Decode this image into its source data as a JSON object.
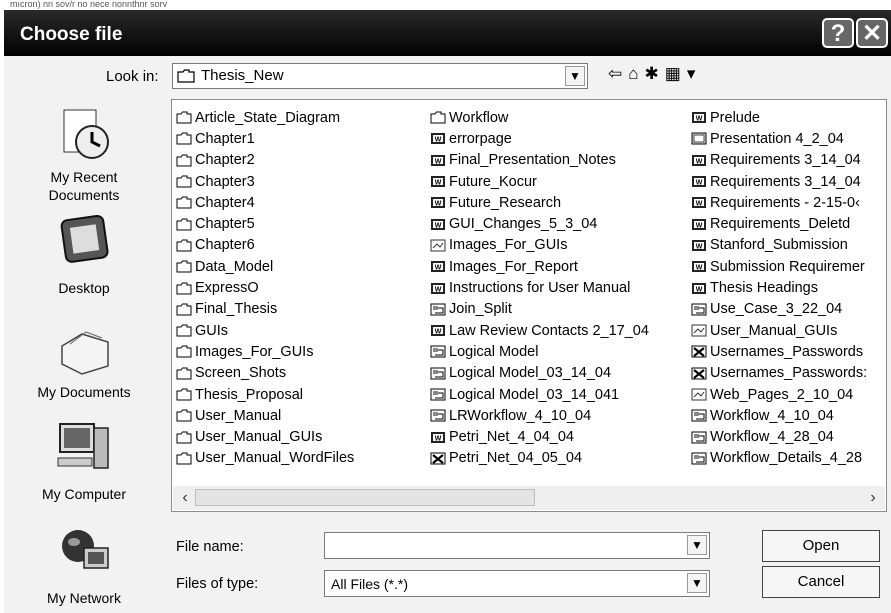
{
  "dialog": {
    "title": "Choose file",
    "help_glyph": "?",
    "close_glyph": "✕"
  },
  "scan_margin_text": "mıcron) nn sov/r no nece nonnthnr sorv",
  "look_in": {
    "label": "Look in:",
    "value": "Thesis_New",
    "dropdown_glyph": "▼"
  },
  "toolbar": {
    "icons": [
      "back-icon",
      "up-folder-icon",
      "new-folder-icon",
      "view-menu-icon"
    ],
    "glyphs": "⇦ ⌂ ✱ ▦▾"
  },
  "places": [
    {
      "label": "My Recent Documents",
      "icon": "recent-documents-icon"
    },
    {
      "label": "Desktop",
      "icon": "desktop-icon"
    },
    {
      "label": "My Documents",
      "icon": "my-documents-icon"
    },
    {
      "label": "My Computer",
      "icon": "my-computer-icon"
    },
    {
      "label": "My Network",
      "icon": "my-network-icon"
    }
  ],
  "files": {
    "columns": [
      [
        {
          "name": "Article_State_Diagram",
          "kind": "folder"
        },
        {
          "name": "Chapter1",
          "kind": "folder"
        },
        {
          "name": "Chapter2",
          "kind": "folder"
        },
        {
          "name": "Chapter3",
          "kind": "folder"
        },
        {
          "name": "Chapter4",
          "kind": "folder"
        },
        {
          "name": "Chapter5",
          "kind": "folder"
        },
        {
          "name": "Chapter6",
          "kind": "folder"
        },
        {
          "name": "Data_Model",
          "kind": "folder"
        },
        {
          "name": "ExpressO",
          "kind": "folder"
        },
        {
          "name": "Final_Thesis",
          "kind": "folder"
        },
        {
          "name": "GUIs",
          "kind": "folder"
        },
        {
          "name": "Images_For_GUIs",
          "kind": "folder"
        },
        {
          "name": "Screen_Shots",
          "kind": "folder"
        },
        {
          "name": "Thesis_Proposal",
          "kind": "folder"
        },
        {
          "name": "User_Manual",
          "kind": "folder"
        },
        {
          "name": "User_Manual_GUIs",
          "kind": "folder"
        },
        {
          "name": "User_Manual_WordFiles",
          "kind": "folder"
        }
      ],
      [
        {
          "name": "Workflow",
          "kind": "folder"
        },
        {
          "name": "errorpage",
          "kind": "word"
        },
        {
          "name": "Final_Presentation_Notes",
          "kind": "word"
        },
        {
          "name": "Future_Kocur",
          "kind": "word"
        },
        {
          "name": "Future_Research",
          "kind": "word"
        },
        {
          "name": "GUI_Changes_5_3_04",
          "kind": "word"
        },
        {
          "name": "Images_For_GUIs",
          "kind": "image"
        },
        {
          "name": "Images_For_Report",
          "kind": "word"
        },
        {
          "name": "Instructions for User Manual",
          "kind": "word"
        },
        {
          "name": "Join_Split",
          "kind": "visio"
        },
        {
          "name": "Law Review Contacts 2_17_04",
          "kind": "word"
        },
        {
          "name": "Logical Model",
          "kind": "visio"
        },
        {
          "name": "Logical Model_03_14_04",
          "kind": "visio"
        },
        {
          "name": "Logical Model_03_14_041",
          "kind": "visio"
        },
        {
          "name": "LRWorkflow_4_10_04",
          "kind": "visio"
        },
        {
          "name": "Petri_Net_4_04_04",
          "kind": "word"
        },
        {
          "name": "Petri_Net_04_05_04",
          "kind": "excel"
        }
      ],
      [
        {
          "name": "Prelude",
          "kind": "word"
        },
        {
          "name": "Presentation 4_2_04",
          "kind": "ppt"
        },
        {
          "name": "Requirements 3_14_04",
          "kind": "word"
        },
        {
          "name": "Requirements 3_14_04",
          "kind": "word"
        },
        {
          "name": "Requirements - 2-15-0‹",
          "kind": "word"
        },
        {
          "name": "Requirements_Deletd",
          "kind": "word"
        },
        {
          "name": "Stanford_Submission",
          "kind": "word"
        },
        {
          "name": "Submission Requiremer",
          "kind": "word"
        },
        {
          "name": "Thesis Headings",
          "kind": "word"
        },
        {
          "name": "Use_Case_3_22_04",
          "kind": "visio"
        },
        {
          "name": "User_Manual_GUIs",
          "kind": "image"
        },
        {
          "name": "Usernames_Passwords",
          "kind": "excel"
        },
        {
          "name": "Usernames_Passwords:",
          "kind": "excel"
        },
        {
          "name": "Web_Pages_2_10_04",
          "kind": "image"
        },
        {
          "name": "Workflow_4_10_04",
          "kind": "visio"
        },
        {
          "name": "Workflow_4_28_04",
          "kind": "visio"
        },
        {
          "name": "Workflow_Details_4_28",
          "kind": "visio"
        }
      ]
    ]
  },
  "scrollbar": {
    "left_glyph": "‹",
    "right_glyph": "›"
  },
  "file_name": {
    "label": "File name:",
    "value": ""
  },
  "file_type": {
    "label": "Files of type:",
    "value": "All Files (*.*)"
  },
  "buttons": {
    "open": "Open",
    "cancel": "Cancel"
  },
  "colors": {
    "titlebar": "#000000",
    "dialog_bg": "#f2f2f2",
    "folder_icon": "#ffffff",
    "word_icon": "#1a1a1a"
  }
}
